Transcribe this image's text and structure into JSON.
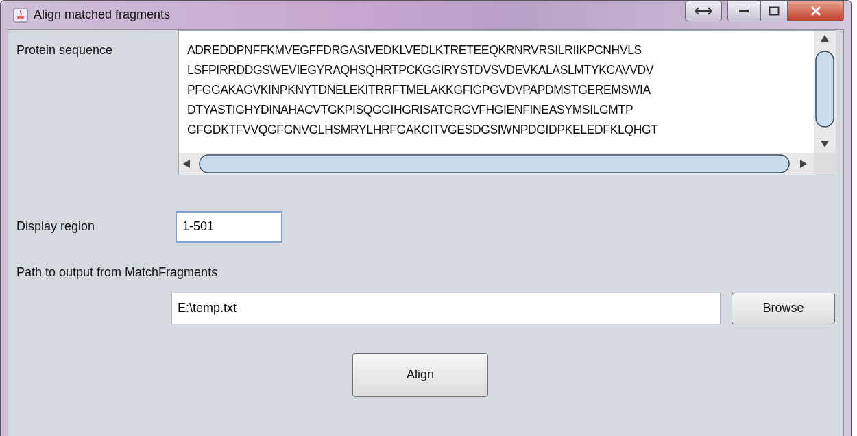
{
  "window": {
    "title": "Align matched fragments"
  },
  "protein_sequence": {
    "label": "Protein sequence",
    "lines": [
      "ADREDDPNFFKMVEGFFDRGASIVEDKLVEDLKTRETEEQKRNRVRSILRIIKPCNHVLS",
      "LSFPIRRDDGSWEVIEGYRAQHSQHRTPCKGGIRYSTDVSVDEVKALASLMTYKCAVVDV",
      "PFGGAKAGVKINPKNYTDNELEKITRRFTMELAKKGFIGPGVDVPAPDMSTGEREMSWIA",
      "DTYASTIGHYDINAHACVTGKPISQGGIHGRISATGRGVFHGIENFINEASYMSILGMTP",
      "GFGDKTFVVQGFGNVGLHSMRYLHRFGAKCITVGESDGSIWNPDGIDPKELEDFKLQHGT"
    ]
  },
  "display_region": {
    "label": "Display region",
    "value": "1-501",
    "focused": true
  },
  "output_path": {
    "label": "Path to output from MatchFragments",
    "value": "E:\\temp.txt",
    "button": "Browse"
  },
  "align_button": "Align"
}
